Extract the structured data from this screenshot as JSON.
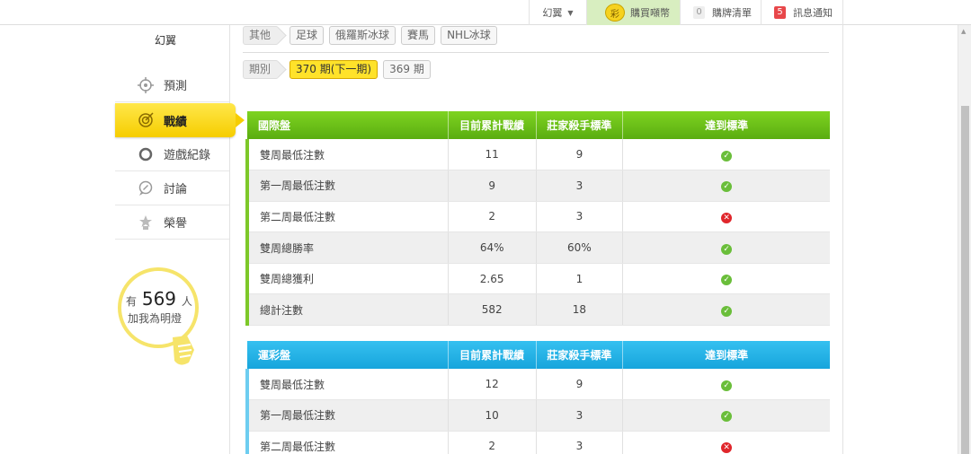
{
  "topbar": {
    "user": "幻翼",
    "buy_badge": "彩",
    "buy_label": "購買噸幣",
    "cart_count": "0",
    "cart_label": "購牌清單",
    "msg_count": "5",
    "msg_label": "訊息通知"
  },
  "sidebar": {
    "title": "幻翼",
    "items": [
      {
        "label": "預測"
      },
      {
        "label": "戰績"
      },
      {
        "label": "遊戲紀錄"
      },
      {
        "label": "討論"
      },
      {
        "label": "榮譽"
      }
    ],
    "fans": {
      "prefix": "有",
      "count": "569",
      "suffix": "人",
      "line2": "加我為明燈"
    }
  },
  "filters": {
    "category_label": "其他",
    "categories": [
      "足球",
      "俄羅斯冰球",
      "賽馬",
      "NHL冰球"
    ],
    "period_label": "期別",
    "periods": [
      "370 期(下一期)",
      "369 期"
    ]
  },
  "colors": {
    "green_header": "#6cc319",
    "blue_header": "#22b0e6",
    "ok": "#6abe3a",
    "fail": "#e0262b",
    "active_nav": "#f6cd00"
  },
  "table_intl": {
    "headers": [
      "國際盤",
      "目前累計戰績",
      "莊家殺手標準",
      "達到標準"
    ],
    "rows": [
      {
        "label": "雙周最低注數",
        "current": "11",
        "standard": "9",
        "status": "ok"
      },
      {
        "label": "第一周最低注數",
        "current": "9",
        "standard": "3",
        "status": "ok"
      },
      {
        "label": "第二周最低注數",
        "current": "2",
        "standard": "3",
        "status": "fail"
      },
      {
        "label": "雙周總勝率",
        "current": "64%",
        "standard": "60%",
        "status": "ok"
      },
      {
        "label": "雙周總獲利",
        "current": "2.65",
        "standard": "1",
        "status": "ok"
      },
      {
        "label": "總計注數",
        "current": "582",
        "standard": "18",
        "status": "ok"
      }
    ]
  },
  "table_lottery": {
    "headers": [
      "運彩盤",
      "目前累計戰績",
      "莊家殺手標準",
      "達到標準"
    ],
    "rows": [
      {
        "label": "雙周最低注數",
        "current": "12",
        "standard": "9",
        "status": "ok"
      },
      {
        "label": "第一周最低注數",
        "current": "10",
        "standard": "3",
        "status": "ok"
      },
      {
        "label": "第二周最低注數",
        "current": "2",
        "standard": "3",
        "status": "fail"
      }
    ]
  }
}
